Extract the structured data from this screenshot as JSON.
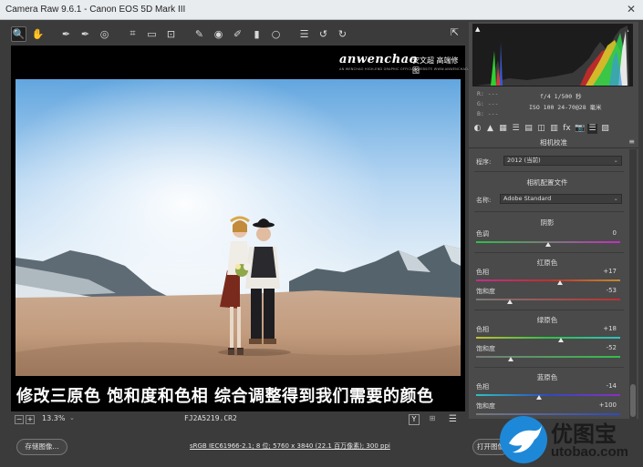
{
  "window": {
    "title": "Camera Raw 9.6.1  -  Canon EOS 5D Mark III",
    "close_glyph": "✕"
  },
  "toolbar": {
    "tools": [
      {
        "name": "zoom-tool",
        "glyph": "🔍",
        "active": true
      },
      {
        "name": "hand-tool",
        "glyph": "✋"
      },
      {
        "name": "white-balance-tool",
        "glyph": "✒"
      },
      {
        "name": "color-sampler-tool",
        "glyph": "✒"
      },
      {
        "name": "targeted-adjustment-tool",
        "glyph": "◎"
      },
      {
        "name": "crop-tool",
        "glyph": "⌗"
      },
      {
        "name": "straighten-tool",
        "glyph": "▭"
      },
      {
        "name": "transform-tool",
        "glyph": "⊡"
      },
      {
        "name": "spot-removal-tool",
        "glyph": "✎"
      },
      {
        "name": "red-eye-tool",
        "glyph": "◉"
      },
      {
        "name": "adjustment-brush-tool",
        "glyph": "✐"
      },
      {
        "name": "graduated-filter-tool",
        "glyph": "▮"
      },
      {
        "name": "radial-filter-tool",
        "glyph": "○"
      },
      {
        "name": "preferences-tool",
        "glyph": "☰"
      },
      {
        "name": "rotate-ccw-tool",
        "glyph": "↺"
      },
      {
        "name": "rotate-cw-tool",
        "glyph": "↻"
      }
    ],
    "open_dialog_glyph": "⇱"
  },
  "brand": {
    "name": "anwenchao",
    "cn": "安文超 高端修图",
    "tagline": "AN WENCHAO HIGH-END GRAPHIC OFFICIAL WEBSITE WWW.ANWENCHAO.COM"
  },
  "caption": "修改三原色  饱和度和色相  综合调整得到我们需要的颜色",
  "status": {
    "zoom_minus": "−",
    "zoom_plus": "+",
    "zoom_level": "13.3%",
    "filename": "FJ2A5219.CR2",
    "y_label": "Y",
    "compare_glyph": "⊞",
    "prefs_glyph": "☰"
  },
  "histogram": {
    "clip_shadow": "▲",
    "clip_highlight": "▲"
  },
  "readout": {
    "r": "R:  ---",
    "g": "G:  ---",
    "b": "B:  ---",
    "aperture_shutter": "f/4   1/500 秒",
    "iso_lens": "ISO 100   24-70@28 毫米"
  },
  "panel": {
    "tab_glyphs": [
      "◐",
      "▲",
      "▦",
      "☰",
      "▤",
      "◫",
      "▥",
      "fx",
      "📷",
      "☰",
      "▨"
    ],
    "title": "相机校准",
    "menu_glyph": "≡",
    "process_label": "程序:",
    "process_value": "2012 (当前)",
    "profile_section": "相机配置文件",
    "name_label": "名称:",
    "name_value": "Adobe Standard",
    "shadows_section": "阴影",
    "shadow_tint_label": "色调",
    "shadow_tint_value": "0",
    "red_section": "红原色",
    "red_hue_label": "色相",
    "red_hue_value": "+17",
    "red_sat_label": "饱和度",
    "red_sat_value": "-53",
    "green_section": "绿原色",
    "green_hue_label": "色相",
    "green_hue_value": "+18",
    "green_sat_label": "饱和度",
    "green_sat_value": "-52",
    "blue_section": "蓝原色",
    "blue_hue_label": "色相",
    "blue_hue_value": "-14",
    "blue_sat_label": "饱和度",
    "blue_sat_value": "+100",
    "caret": "⌄"
  },
  "bottom": {
    "save_button": "存储图像...",
    "workflow": "sRGB IEC61966-2.1; 8 位; 5760 x 3840 (22.1 百万像素); 300 ppi",
    "open_button": "打开图像"
  },
  "watermark": {
    "text": "优图宝",
    "url": "utobao.com"
  },
  "colors": {
    "accent": "#1e88d8",
    "panel_bg": "#4a4a4a",
    "window_bg": "#3b3b3b"
  }
}
